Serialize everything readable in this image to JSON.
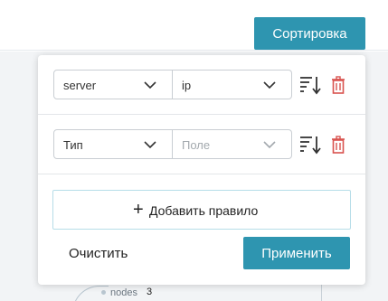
{
  "header": {
    "sort_button_label": "Сортировка"
  },
  "background": {
    "node_label": "nodes",
    "node_count": "3"
  },
  "sort_panel": {
    "rules": [
      {
        "field": "server",
        "value": "ip",
        "value_is_placeholder": false
      },
      {
        "field": "Тип",
        "value": "Поле",
        "value_is_placeholder": true
      }
    ],
    "add_rule_label": "Добавить правило",
    "clear_label": "Очистить",
    "apply_label": "Применить"
  },
  "colors": {
    "accent": "#2e95b0",
    "delete_icon": "#d9534f",
    "add_button_border": "#b6dde8"
  },
  "icons": {
    "sort": "sort-descending-icon",
    "delete": "trash-icon",
    "dropdown": "chevron-down-icon",
    "add": "plus-icon"
  }
}
